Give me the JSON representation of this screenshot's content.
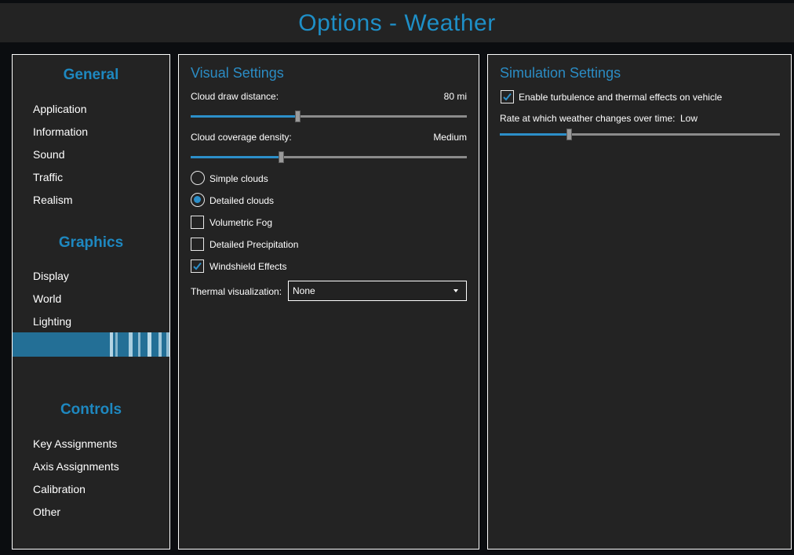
{
  "header": {
    "title": "Options - Weather"
  },
  "sidebar": {
    "sections": [
      {
        "title": "General",
        "items": [
          "Application",
          "Information",
          "Sound",
          "Traffic",
          "Realism"
        ]
      },
      {
        "title": "Graphics",
        "items": [
          "Display",
          "World",
          "Lighting"
        ]
      },
      {
        "title": "Controls",
        "items": [
          "Key Assignments",
          "Axis Assignments",
          "Calibration",
          "Other"
        ]
      }
    ]
  },
  "visual": {
    "title": "Visual Settings",
    "cloud_draw_distance": {
      "label": "Cloud draw distance:",
      "value": "80 mi",
      "level": 0.39
    },
    "cloud_coverage": {
      "label": "Cloud coverage density:",
      "value": "Medium",
      "level": 0.33
    },
    "cloud_mode": {
      "options": [
        "Simple clouds",
        "Detailed clouds"
      ],
      "selected": "Detailed clouds"
    },
    "checkboxes": [
      {
        "label": "Volumetric Fog",
        "checked": false
      },
      {
        "label": "Detailed Precipitation",
        "checked": false
      },
      {
        "label": "Windshield Effects",
        "checked": true
      }
    ],
    "thermal": {
      "label": "Thermal visualization:",
      "value": "None"
    }
  },
  "simulation": {
    "title": "Simulation Settings",
    "turbulence": {
      "label": "Enable turbulence and thermal effects on vehicle",
      "checked": true
    },
    "rate": {
      "label": "Rate at which weather changes over time:",
      "value": "Low",
      "level": 0.25
    }
  },
  "colors": {
    "accent": "#2c8fc9",
    "panel_bg": "#232323",
    "selected_nav": "#236f96"
  }
}
